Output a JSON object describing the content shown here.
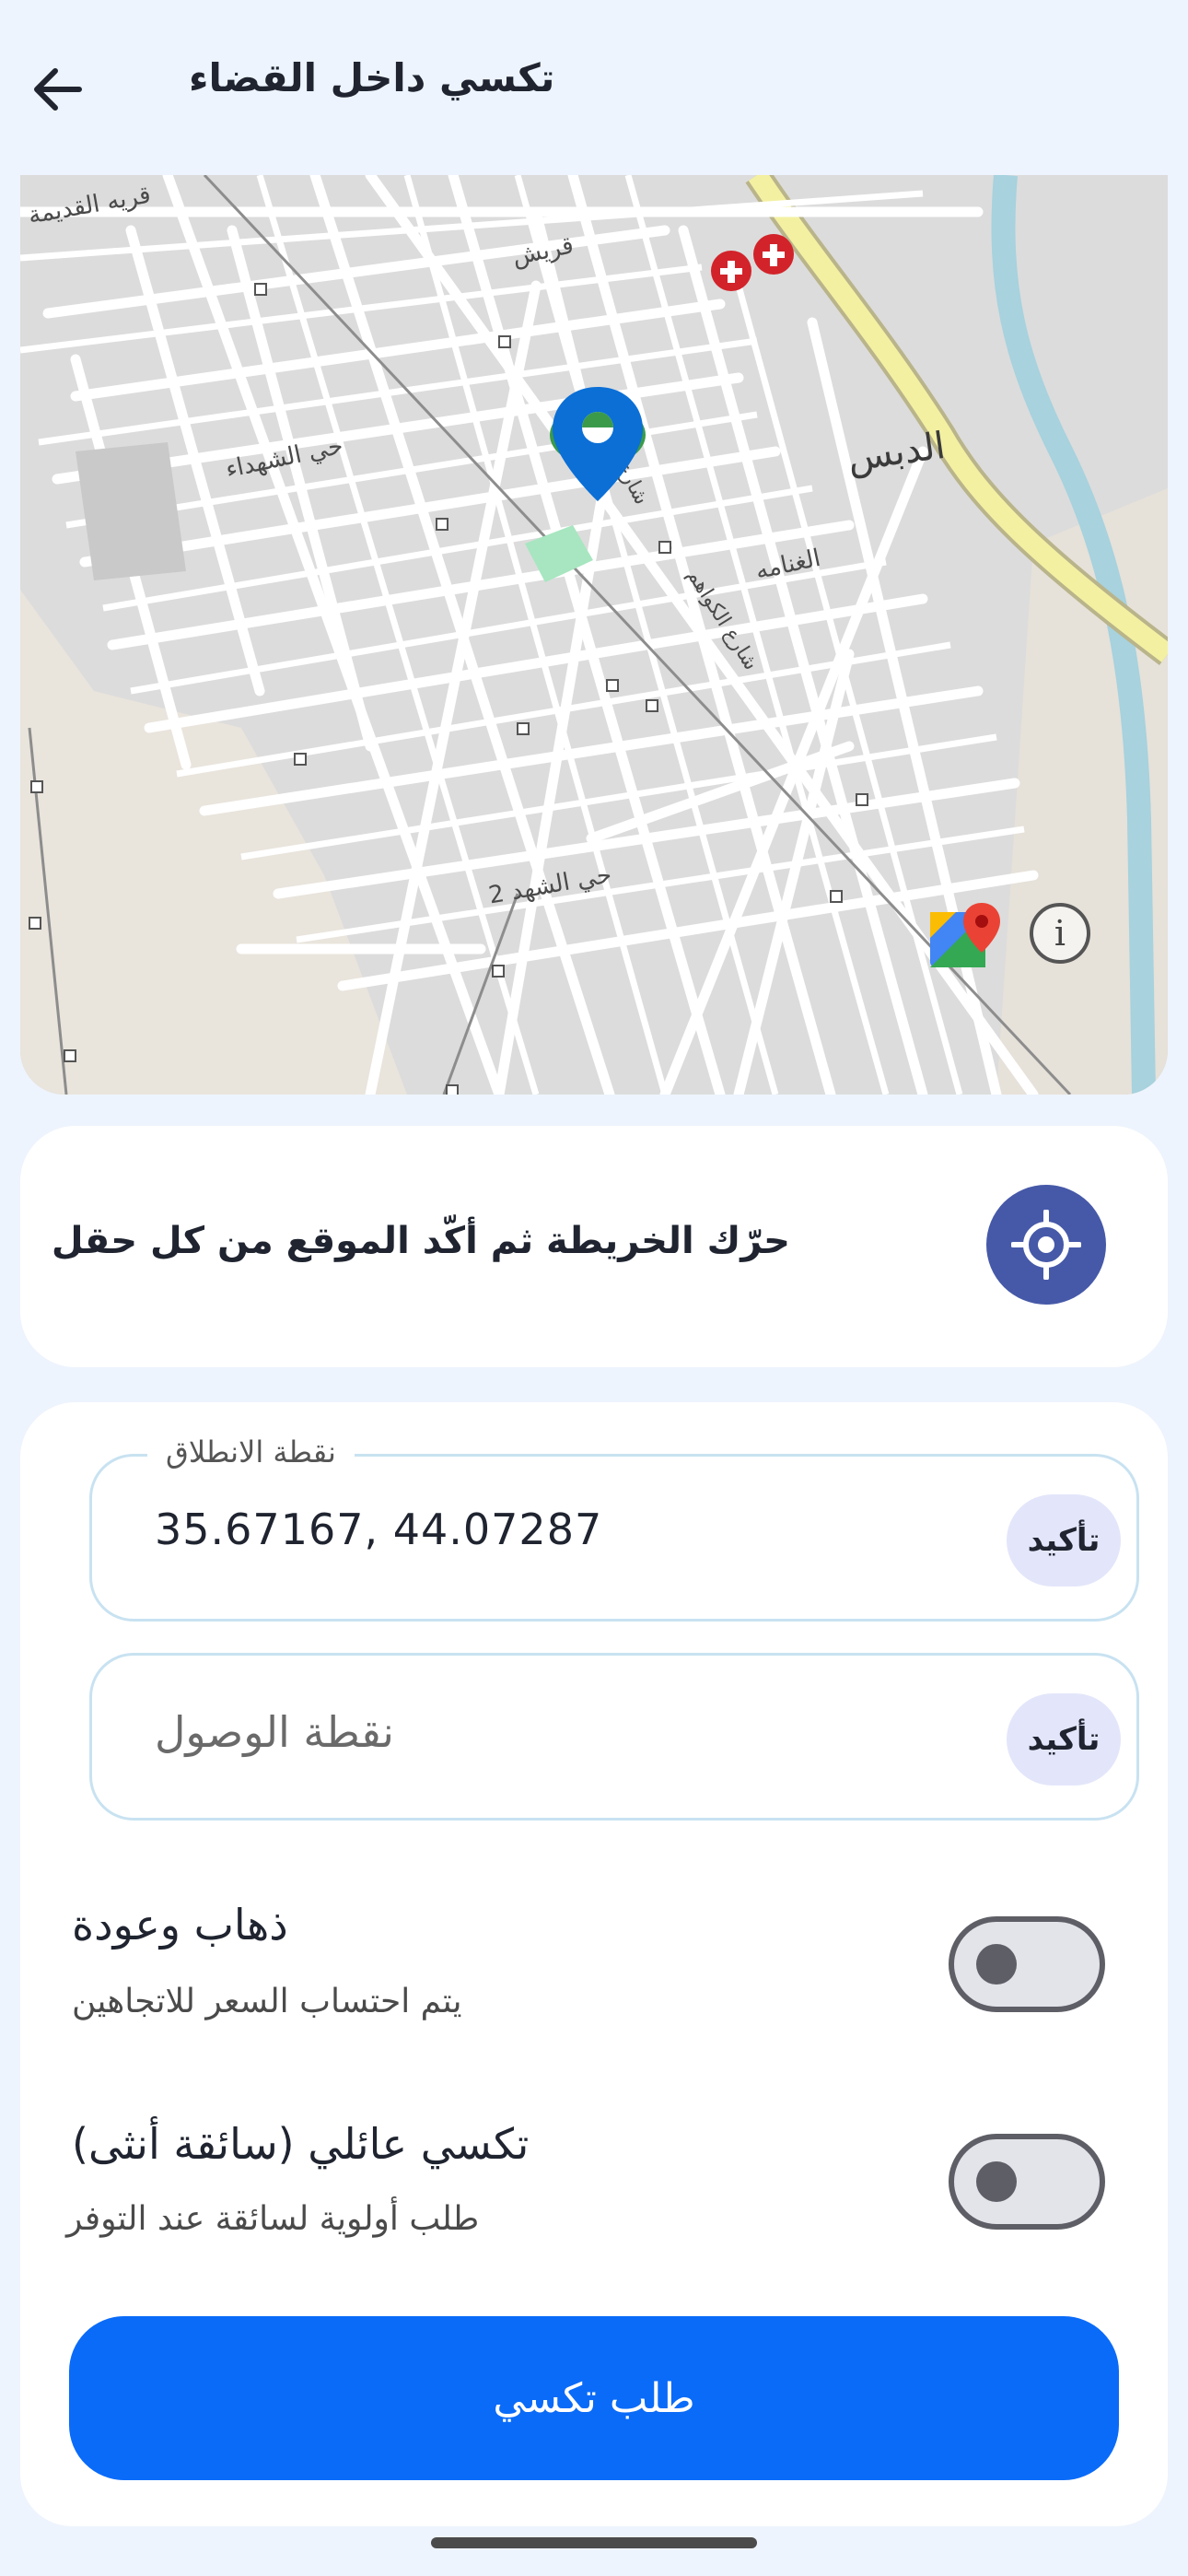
{
  "header": {
    "title": "تكسي داخل القضاء"
  },
  "map": {
    "labels": {
      "old_village": "قريه القديمة",
      "quraish": "قريش",
      "shuhada": "حي الشهداء",
      "dibis": "الدبس",
      "ghanama": "الغنامه",
      "street_1": "شارع",
      "street_kawaz": "شارع الكواهم",
      "shuhada_2": "حي الشهد 2"
    },
    "info_glyph": "i"
  },
  "hint": {
    "text": "حرّك الخريطة ثم أكّد الموقع من كل حقل"
  },
  "form": {
    "start": {
      "legend": "نقطة الانطلاق",
      "value": "35.67167, 44.07287",
      "confirm_label": "تأكيد"
    },
    "destination": {
      "placeholder": "نقطة الوصول",
      "confirm_label": "تأكيد"
    },
    "round_trip": {
      "title": "ذهاب وعودة",
      "subtitle": "يتم احتساب السعر للاتجاهين",
      "enabled": false
    },
    "family_taxi": {
      "title": "تكسي عائلي (سائقة أنثى)",
      "subtitle": "طلب أولوية لسائقة عند التوفر",
      "enabled": false
    },
    "submit_label": "طلب تكسي"
  },
  "colors": {
    "background": "#eef4fd",
    "primary": "#0a6bf8",
    "locate_button": "#4659a8",
    "confirm_chip": "#e3e6fa",
    "field_border": "#c8e2f1",
    "pin_blue": "#0b6fd6",
    "pin_green": "#3a9a4a"
  },
  "icons": {
    "back": "arrow-left-icon",
    "locate": "crosshair-icon",
    "pin": "map-pin-icon",
    "info": "info-icon",
    "maps_logo": "google-maps-icon"
  }
}
